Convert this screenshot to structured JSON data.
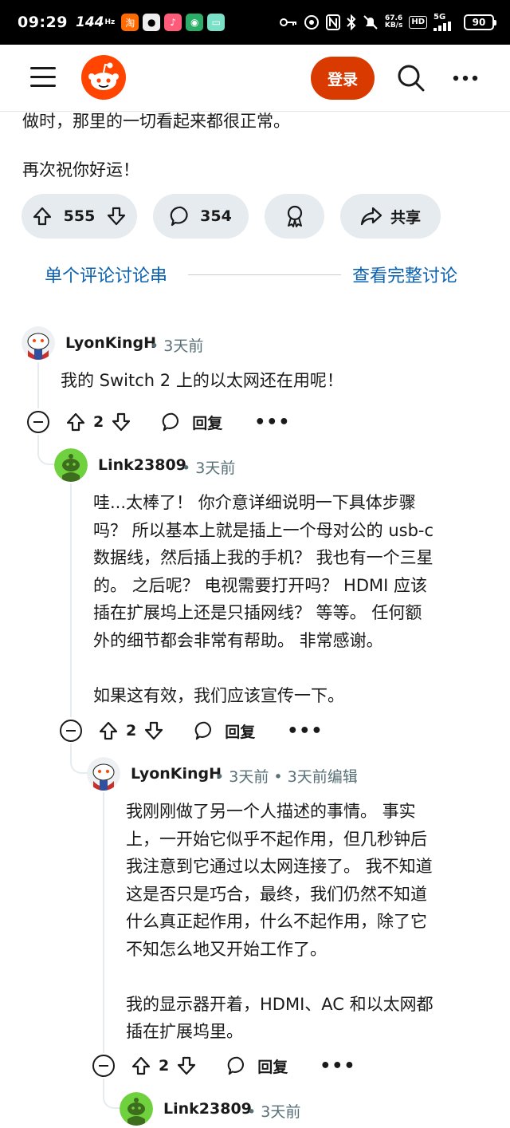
{
  "status_bar": {
    "time": "09:29",
    "refresh_rate": "144",
    "refresh_unit": "Hz",
    "net_speed_value": "67.6",
    "net_speed_unit": "KB/s",
    "hd_label": "HD",
    "signal_label": "5G",
    "battery": "90"
  },
  "header": {
    "login_label": "登录"
  },
  "post": {
    "text_line_1": "做时，那里的一切看起来都很正常。",
    "text_line_2": "再次祝你好运！",
    "upvotes": "555",
    "comments": "354",
    "share_label": "共享"
  },
  "thread_links": {
    "single_thread": "单个评论讨论串",
    "view_full": "查看完整讨论"
  },
  "comments": [
    {
      "author": "LyonKingH",
      "meta": "• 3天前",
      "body_lines": [
        "我的 Switch 2 上的以太网还在用呢！"
      ],
      "votes": "2",
      "reply_label": "回复",
      "more_label": "•••"
    },
    {
      "author": "Link23809",
      "meta": "• 3天前",
      "body_lines": [
        "哇...太棒了！ 你介意详细说明一下具体步骤",
        "吗？ 所以基本上就是插上一个母对公的 usb-c",
        "数据线，然后插上我的手机？ 我也有一个三星",
        "的。 之后呢？ 电视需要打开吗？ HDMI 应该",
        "插在扩展坞上还是只插网线？ 等等。 任何额",
        "外的细节都会非常有帮助。 非常感谢。",
        "",
        "如果这有效，我们应该宣传一下。"
      ],
      "votes": "2",
      "reply_label": "回复",
      "more_label": "•••"
    },
    {
      "author": "LyonKingH",
      "meta": "• 3天前 • 3天前编辑",
      "body_lines": [
        "我刚刚做了另一个人描述的事情。 事实",
        "上，一开始它似乎不起作用，但几秒钟后",
        "我注意到它通过以太网连接了。 我不知道",
        "这是否只是巧合，最终，我们仍然不知道",
        "什么真正起作用，什么不起作用，除了它",
        "不知怎么地又开始工作了。",
        "",
        "我的显示器开着，HDMI、AC 和以太网都",
        "插在扩展坞里。"
      ],
      "votes": "2",
      "reply_label": "回复",
      "more_label": "•••"
    },
    {
      "author": "Link23809",
      "meta": "• 3天前"
    }
  ],
  "colors": {
    "brand": "#ff4500",
    "login_button": "#d93a00",
    "link": "#0a62b0",
    "pill_bg": "#e5ebee",
    "meta_text": "#576f76"
  }
}
